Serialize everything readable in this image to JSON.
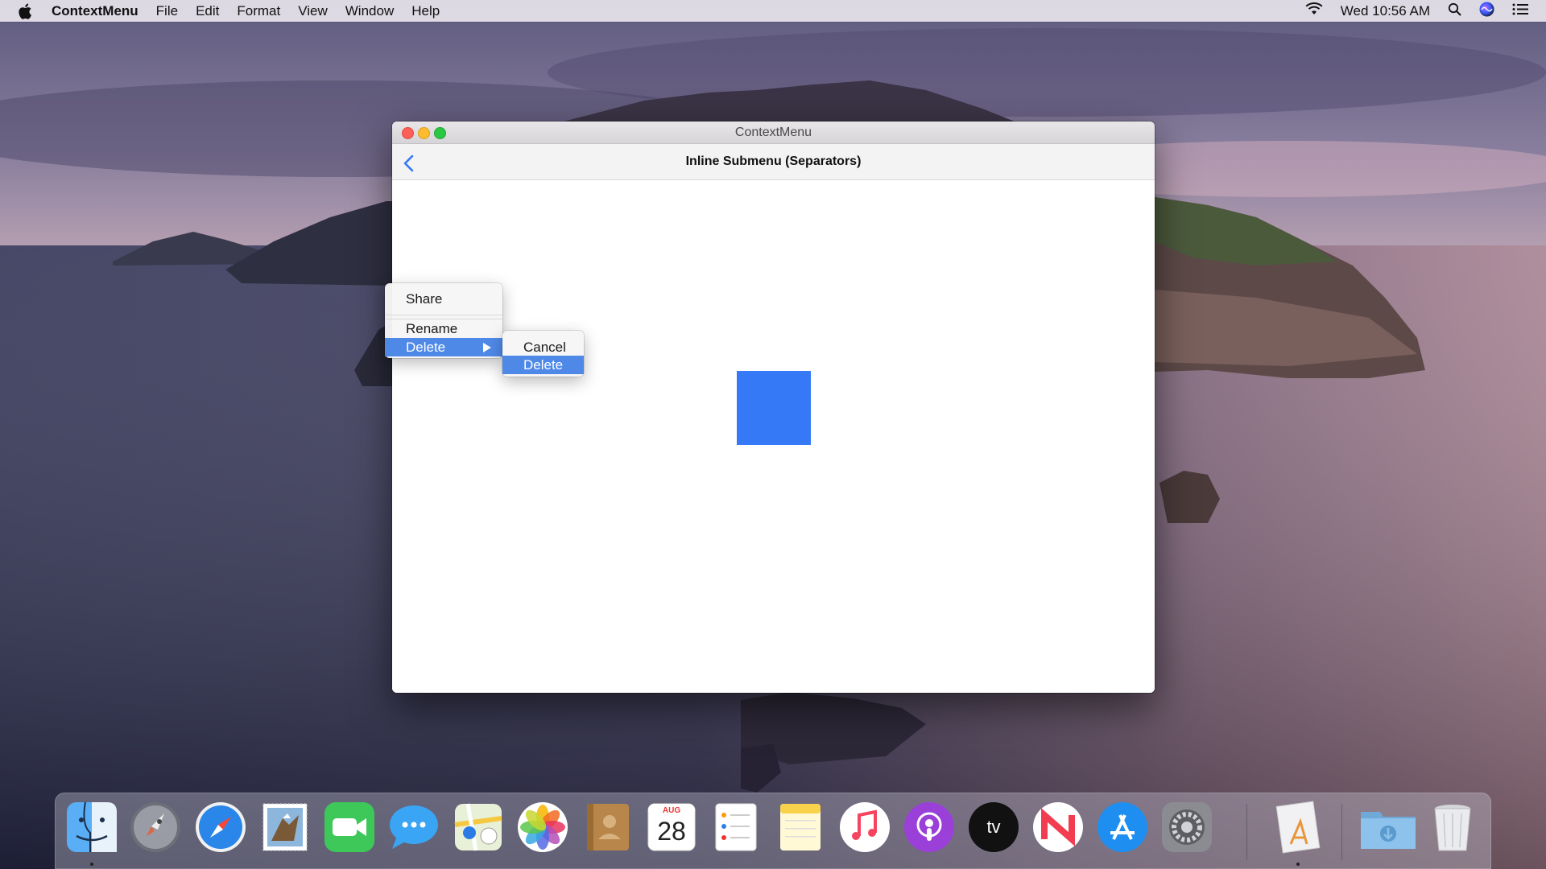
{
  "menubar": {
    "app_name": "ContextMenu",
    "menus": [
      "File",
      "Edit",
      "Format",
      "View",
      "Window",
      "Help"
    ],
    "clock": "Wed 10:56 AM",
    "status_icons": [
      "wifi-icon",
      "search-icon",
      "siri-icon",
      "notification-center-icon"
    ]
  },
  "window": {
    "title": "ContextMenu",
    "nav_title": "Inline Submenu (Separators)"
  },
  "context_menu": {
    "items": [
      "Share",
      "Rename",
      "Delete"
    ],
    "selected": "Delete"
  },
  "submenu": {
    "items": [
      "Cancel",
      "Delete"
    ],
    "selected": "Delete"
  },
  "dock": {
    "apps": [
      "Finder",
      "Launchpad",
      "Safari",
      "Mail",
      "FaceTime",
      "Messages",
      "Maps",
      "Photos",
      "Contacts",
      "Calendar",
      "Reminders",
      "Notes",
      "Music",
      "Podcasts",
      "TV",
      "News",
      "App Store",
      "System Preferences",
      "Xcode",
      "Downloads",
      "Trash"
    ],
    "calendar_month": "AUG",
    "calendar_day": "28",
    "tv_label": "tv"
  },
  "colors": {
    "accent_blue": "#3579f6",
    "menu_selection": "#4f89e8"
  }
}
